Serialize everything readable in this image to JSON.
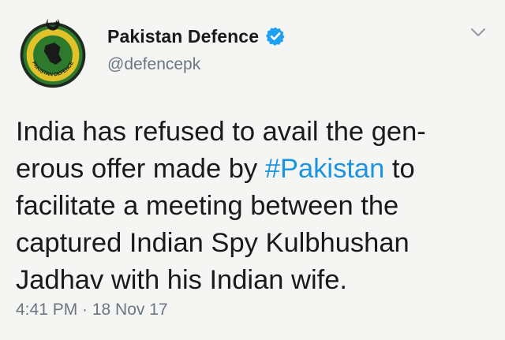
{
  "account": {
    "display_name": "Pakistan Defence",
    "handle": "@defencepk",
    "avatar_icon": "pakistan-defence-emblem",
    "avatar_text": "PAKISTAN DEFENCE",
    "verified_icon": "verified-badge-icon"
  },
  "colors": {
    "hashtag": "#1b95e0",
    "verified": "#1da1f2",
    "muted": "#6b7680",
    "emblem_green": "#2d7a2d",
    "emblem_yellow": "#e2c22a"
  },
  "tweet": {
    "line1": "India has refused to avail the gen-",
    "line2_before": "erous offer made by ",
    "hashtag": "#Pakistan",
    "line2_after": " to",
    "line3": "facilitate a meeting between the",
    "line4": "captured Indian Spy Kulbhushan",
    "line5": "Jadhav with his Indian wife."
  },
  "meta": {
    "timestamp": "4:41 PM · 18 Nov 17"
  },
  "menu": {
    "caret_icon": "chevron-down-icon"
  }
}
